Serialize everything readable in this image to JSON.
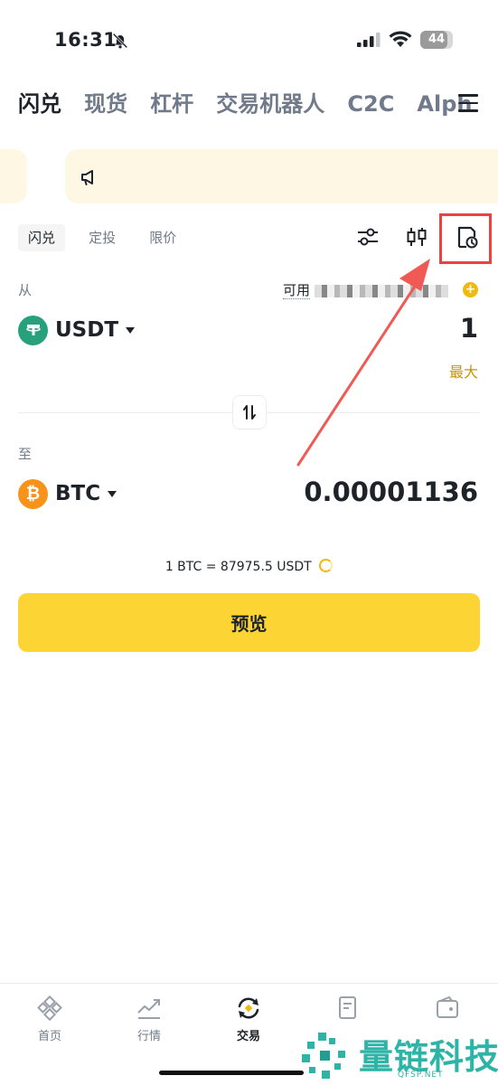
{
  "status_bar": {
    "time": "16:31",
    "battery": "44"
  },
  "top_tabs": [
    {
      "label": "闪兑",
      "active": true
    },
    {
      "label": "现货",
      "active": false
    },
    {
      "label": "杠杆",
      "active": false
    },
    {
      "label": "交易机器人",
      "active": false
    },
    {
      "label": "C2C",
      "active": false
    },
    {
      "label": "Alph",
      "active": false
    }
  ],
  "mode_tabs": [
    {
      "label": "闪兑",
      "active": true
    },
    {
      "label": "定投",
      "active": false
    },
    {
      "label": "限价",
      "active": false
    }
  ],
  "from": {
    "label": "从",
    "available_label": "可用",
    "coin": "USDT",
    "amount": "1",
    "max_label": "最大"
  },
  "to": {
    "label": "至",
    "coin": "BTC",
    "amount": "0.00001136"
  },
  "rate": "1 BTC = 87975.5 USDT",
  "preview_label": "预览",
  "bottom_nav": [
    {
      "label": "首页",
      "active": false
    },
    {
      "label": "行情",
      "active": false
    },
    {
      "label": "交易",
      "active": true
    }
  ],
  "watermark": {
    "text": "量链科技",
    "sub": "QFSP.NET"
  },
  "colors": {
    "brand_yellow": "#fcd535",
    "accent_gold": "#f0b90b",
    "annotation_red": "#e8433f",
    "usdt_green": "#26a17b",
    "btc_orange": "#f7931a"
  }
}
